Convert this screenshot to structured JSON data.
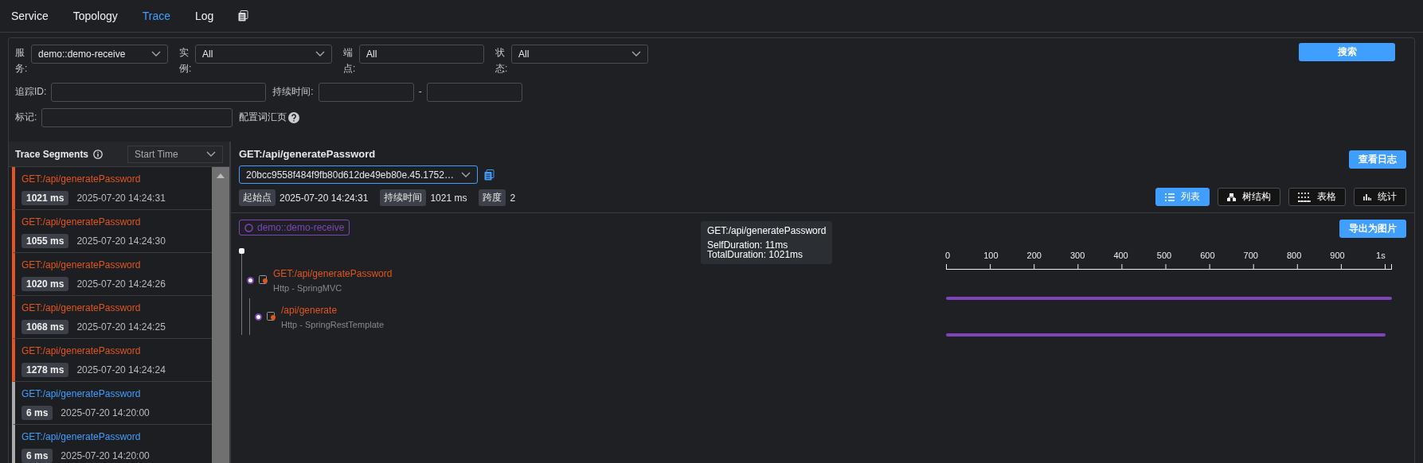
{
  "nav": {
    "tabs": [
      {
        "label": "Service",
        "selected": false
      },
      {
        "label": "Topology",
        "selected": false
      },
      {
        "label": "Trace",
        "selected": true
      },
      {
        "label": "Log",
        "selected": false
      }
    ]
  },
  "filters": {
    "rows": [
      [
        {
          "kind": "select",
          "label": "服务:",
          "value": "demo::demo-receive"
        },
        {
          "kind": "select",
          "label": "实例:",
          "value": "All"
        },
        {
          "kind": "input",
          "label": "端点:",
          "value": "All"
        },
        {
          "kind": "select",
          "label": "状态:",
          "value": "All"
        }
      ],
      [
        {
          "kind": "blank",
          "label": "追踪ID:"
        },
        {
          "kind": "range",
          "label": "持续时间:",
          "separator": "-"
        }
      ],
      [
        {
          "kind": "blank",
          "label": "标记:"
        },
        {
          "kind": "link",
          "label": "配置词汇页"
        }
      ]
    ],
    "search_button": "搜索"
  },
  "segments": {
    "title": "Trace Segments",
    "sort": "Start Time",
    "items": [
      {
        "endpoint": "GET:/api/generatePassword",
        "duration": "1021 ms",
        "time": "2025-07-20 14:24:31",
        "error": true
      },
      {
        "endpoint": "GET:/api/generatePassword",
        "duration": "1055 ms",
        "time": "2025-07-20 14:24:30",
        "error": true
      },
      {
        "endpoint": "GET:/api/generatePassword",
        "duration": "1020 ms",
        "time": "2025-07-20 14:24:26",
        "error": true
      },
      {
        "endpoint": "GET:/api/generatePassword",
        "duration": "1068 ms",
        "time": "2025-07-20 14:24:25",
        "error": true
      },
      {
        "endpoint": "GET:/api/generatePassword",
        "duration": "1278 ms",
        "time": "2025-07-20 14:24:24",
        "error": true
      },
      {
        "endpoint": "GET:/api/generatePassword",
        "duration": "6 ms",
        "time": "2025-07-20 14:20:00",
        "error": false
      },
      {
        "endpoint": "GET:/api/generatePassword",
        "duration": "6 ms",
        "time": "2025-07-20 14:20:00",
        "error": false
      }
    ]
  },
  "detail": {
    "title": "GET:/api/generatePassword",
    "trace_id": "20bcc9558f484f9fb80d612de49eb80e.45.1752…",
    "log_button": "查看日志",
    "meta": [
      {
        "label": "起始点",
        "value": "2025-07-20 14:24:31"
      },
      {
        "label": "持续时间",
        "value": "1021 ms"
      },
      {
        "label": "跨度",
        "value": "2"
      }
    ],
    "views": [
      {
        "kind": "list",
        "label": "列表",
        "selected": true
      },
      {
        "kind": "tree",
        "label": "树结构",
        "selected": false
      },
      {
        "kind": "table",
        "label": "表格",
        "selected": false
      },
      {
        "kind": "stats",
        "label": "统计",
        "selected": false
      }
    ],
    "service": "demo::demo-receive",
    "export_button": "导出为图片",
    "tooltip": {
      "title": "GET:/api/generatePassword",
      "lines": [
        "SelfDuration: 11ms",
        "TotalDuration: 1021ms"
      ]
    },
    "axis": [
      "0",
      "100",
      "200",
      "300",
      "400",
      "500",
      "600",
      "700",
      "800",
      "900",
      "1s"
    ],
    "spans": [
      {
        "name": "GET:/api/generatePassword",
        "component": "Http - SpringMVC",
        "level": 1,
        "children": [
          {
            "name": "/api/generate",
            "component": "Http - SpringRestTemplate",
            "level": 0.985
          }
        ]
      }
    ]
  }
}
